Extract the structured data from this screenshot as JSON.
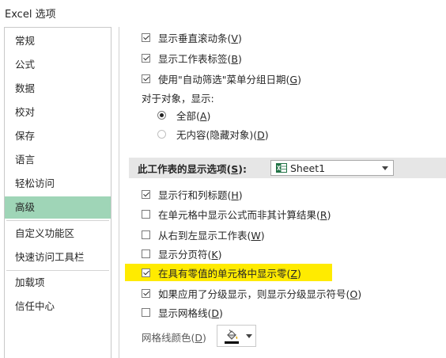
{
  "window": {
    "title": "Excel 选项"
  },
  "sidebar": {
    "items": [
      {
        "label": "常规"
      },
      {
        "label": "公式"
      },
      {
        "label": "数据"
      },
      {
        "label": "校对"
      },
      {
        "label": "保存"
      },
      {
        "label": "语言"
      },
      {
        "label": "轻松访问"
      },
      {
        "label": "高级",
        "selected": true
      },
      {
        "label": "自定义功能区"
      },
      {
        "label": "快速访问工具栏"
      },
      {
        "label": "加载项"
      },
      {
        "label": "信任中心"
      }
    ]
  },
  "workbook_options": {
    "show_vscroll": {
      "label": "显示垂直滚动条(",
      "key": "V",
      "end": ")",
      "checked": true
    },
    "show_tabs": {
      "label": "显示工作表标签(",
      "key": "B",
      "end": ")",
      "checked": true
    },
    "group_dates": {
      "label": "使用\"自动筛选\"菜单分组日期(",
      "key": "G",
      "end": ")",
      "checked": true
    },
    "objects_label": "对于对象，显示:",
    "radio_all": {
      "label": "全部(",
      "key": "A",
      "end": ")",
      "checked": true
    },
    "radio_none": {
      "label": "无内容(隐藏对象)(",
      "key": "D",
      "end": ")",
      "checked": false
    }
  },
  "sheet_section": {
    "title_prefix": "此工作表的显示选项(",
    "title_key": "S",
    "title_end": "):",
    "sheet_select": "Sheet1"
  },
  "sheet_options": {
    "row_col_headers": {
      "label": "显示行和列标题(",
      "key": "H",
      "end": ")",
      "checked": true
    },
    "show_formulas": {
      "label": "在单元格中显示公式而非其计算结果(",
      "key": "R",
      "end": ")",
      "checked": false
    },
    "rtl": {
      "label": "从右到左显示工作表(",
      "key": "W",
      "end": ")",
      "checked": false
    },
    "page_breaks": {
      "label": "显示分页符(",
      "key": "K",
      "end": ")",
      "checked": false
    },
    "show_zero": {
      "label": "在具有零值的单元格中显示零(",
      "key": "Z",
      "end": ")",
      "checked": true
    },
    "outline_symbols": {
      "label": "如果应用了分级显示，则显示分级显示符号(",
      "key": "O",
      "end": ")",
      "checked": true
    },
    "gridlines": {
      "label": "显示网格线(",
      "key": "D",
      "end": ")",
      "checked": false
    },
    "grid_color_label": "网格线颜色(",
    "grid_color_key": "D",
    "grid_color_end": ")",
    "grid_color_value": "#000000"
  },
  "colors": {
    "selected_nav": "#9fd5b7",
    "highlight": "#ffeb00",
    "section_bg": "#e6e6e6"
  }
}
